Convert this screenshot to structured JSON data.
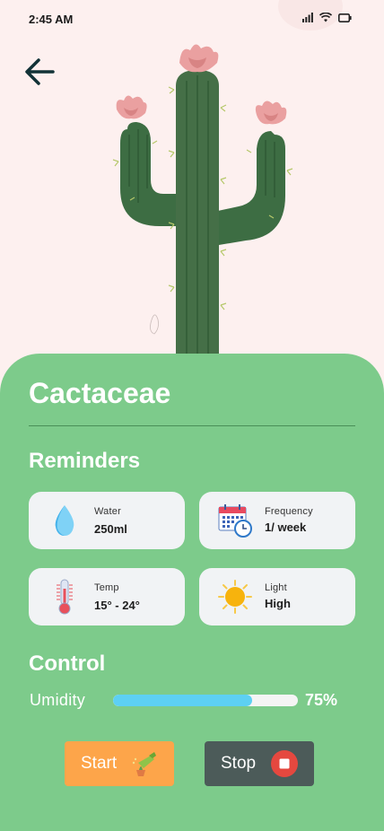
{
  "status_bar": {
    "time": "2:45 AM",
    "icons": [
      "signal-icon",
      "wifi-icon",
      "battery-icon"
    ]
  },
  "header": {
    "back_icon": "arrow-left-icon"
  },
  "plant": {
    "name": "Cactaceae",
    "image": "cactus-illustration"
  },
  "reminders": {
    "title": "Reminders",
    "items": [
      {
        "label": "Water",
        "value": "250ml",
        "icon": "water-drop-icon"
      },
      {
        "label": "Frequency",
        "value": "1/ week",
        "icon": "calendar-clock-icon"
      },
      {
        "label": "Temp",
        "value": "15° - 24°",
        "icon": "thermometer-icon"
      },
      {
        "label": "Light",
        "value": "High",
        "icon": "sun-icon"
      }
    ]
  },
  "control": {
    "title": "Control",
    "humidity_label": "Umidity",
    "humidity_value": "75%",
    "humidity_percent": 75,
    "start_label": "Start",
    "stop_label": "Stop",
    "start_icon": "watering-can-icon",
    "stop_icon": "stop-icon"
  },
  "colors": {
    "background": "#fdf0ef",
    "panel": "#7dcb8b",
    "card": "#f1f3f5",
    "start_button": "#fda54a",
    "stop_button": "#4c5b59",
    "progress_fill": "#5dd0f3",
    "stop_accent": "#e5483f"
  }
}
